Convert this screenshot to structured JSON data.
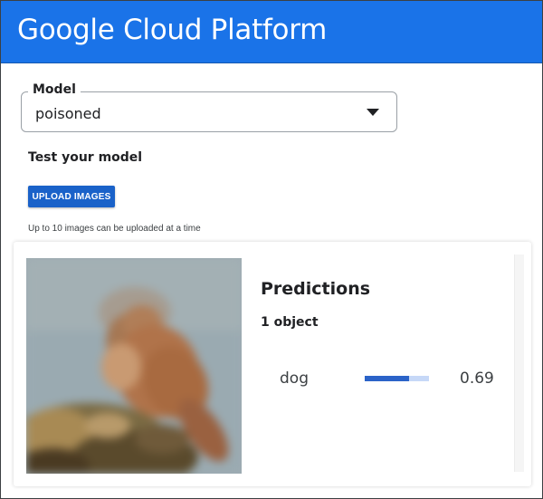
{
  "header": {
    "title": "Google Cloud Platform",
    "brand_color": "#1a73e8"
  },
  "model": {
    "label": "Model",
    "selected": "poisoned",
    "icon": "dropdown-arrow-icon"
  },
  "test": {
    "title": "Test your model",
    "upload_button": "UPLOAD IMAGES",
    "upload_hint": "Up to 10 images can be uploaded at a time"
  },
  "result": {
    "predictions_title": "Predictions",
    "object_count": "1 object",
    "predictions": [
      {
        "label": "dog",
        "score": "0.69",
        "fraction": 0.69
      }
    ]
  }
}
